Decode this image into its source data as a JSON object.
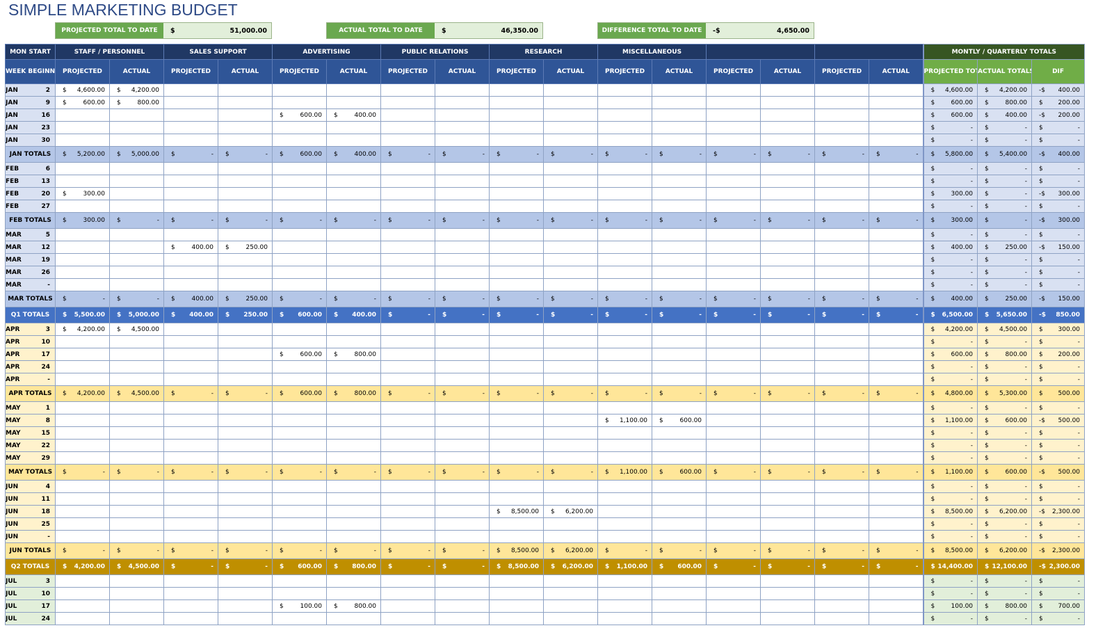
{
  "title": "SIMPLE MARKETING BUDGET",
  "summary": [
    {
      "label": "PROJECTED TOTAL TO DATE",
      "currency": "$",
      "value": "51,000.00"
    },
    {
      "label": "ACTUAL TOTAL TO DATE",
      "currency": "$",
      "value": "46,350.00"
    },
    {
      "label": "DIFFERENCE TOTAL TO DATE",
      "currency": "-$",
      "value": "4,650.00"
    }
  ],
  "header": {
    "corner_top": "MON START",
    "corner_bottom": "WEEK BEGINNING",
    "categories": [
      "STAFF / PERSONNEL",
      "SALES SUPPORT",
      "ADVERTISING",
      "PUBLIC RELATIONS",
      "RESEARCH",
      "MISCELLANEOUS",
      "",
      ""
    ],
    "sub": [
      "PROJECTED",
      "ACTUAL"
    ],
    "totals_group": "MONTLY / QUARTERLY TOTALS",
    "totals_sub": [
      "PROJECTED TOTALS",
      "ACTUAL TOTALS",
      "DIF"
    ]
  },
  "rows": [
    {
      "type": "week",
      "q": 1,
      "month": "JAN",
      "day": "2",
      "cells": {
        "0": "4,600.00",
        "1": "4,200.00"
      },
      "totals": [
        "$|4,600.00",
        "$|4,200.00",
        "-$|400.00"
      ]
    },
    {
      "type": "week",
      "q": 1,
      "month": "JAN",
      "day": "9",
      "cells": {
        "0": "600.00",
        "1": "800.00"
      },
      "totals": [
        "$|600.00",
        "$|800.00",
        "$|200.00"
      ]
    },
    {
      "type": "week",
      "q": 1,
      "month": "JAN",
      "day": "16",
      "cells": {
        "4": "600.00",
        "5": "400.00"
      },
      "totals": [
        "$|600.00",
        "$|400.00",
        "-$|200.00"
      ]
    },
    {
      "type": "week",
      "q": 1,
      "month": "JAN",
      "day": "23",
      "cells": {},
      "totals": [
        "$|-",
        "$|-",
        "$|-"
      ]
    },
    {
      "type": "week",
      "q": 1,
      "month": "JAN",
      "day": "30",
      "cells": {},
      "totals": [
        "$|-",
        "$|-",
        "$|-"
      ]
    },
    {
      "type": "month",
      "q": 1,
      "label": "JAN TOTALS",
      "values": [
        "5,200.00",
        "5,000.00",
        "-",
        "-",
        "600.00",
        "400.00",
        "-",
        "-",
        "-",
        "-",
        "-",
        "-",
        "-",
        "-",
        "-",
        "-"
      ],
      "totals": [
        "$|5,800.00",
        "$|5,400.00",
        "-$|400.00"
      ]
    },
    {
      "type": "week",
      "q": 1,
      "month": "FEB",
      "day": "6",
      "cells": {},
      "totals": [
        "$|-",
        "$|-",
        "$|-"
      ]
    },
    {
      "type": "week",
      "q": 1,
      "month": "FEB",
      "day": "13",
      "cells": {},
      "totals": [
        "$|-",
        "$|-",
        "$|-"
      ]
    },
    {
      "type": "week",
      "q": 1,
      "month": "FEB",
      "day": "20",
      "cells": {
        "0": "300.00"
      },
      "totals": [
        "$|300.00",
        "$|-",
        "-$|300.00"
      ]
    },
    {
      "type": "week",
      "q": 1,
      "month": "FEB",
      "day": "27",
      "cells": {},
      "totals": [
        "$|-",
        "$|-",
        "$|-"
      ]
    },
    {
      "type": "month",
      "q": 1,
      "label": "FEB TOTALS",
      "values": [
        "300.00",
        "-",
        "-",
        "-",
        "-",
        "-",
        "-",
        "-",
        "-",
        "-",
        "-",
        "-",
        "-",
        "-",
        "-",
        "-"
      ],
      "totals": [
        "$|300.00",
        "$|-",
        "-$|300.00"
      ]
    },
    {
      "type": "week",
      "q": 1,
      "month": "MAR",
      "day": "5",
      "cells": {},
      "totals": [
        "$|-",
        "$|-",
        "$|-"
      ]
    },
    {
      "type": "week",
      "q": 1,
      "month": "MAR",
      "day": "12",
      "cells": {
        "2": "400.00",
        "3": "250.00"
      },
      "totals": [
        "$|400.00",
        "$|250.00",
        "-$|150.00"
      ]
    },
    {
      "type": "week",
      "q": 1,
      "month": "MAR",
      "day": "19",
      "cells": {},
      "totals": [
        "$|-",
        "$|-",
        "$|-"
      ]
    },
    {
      "type": "week",
      "q": 1,
      "month": "MAR",
      "day": "26",
      "cells": {},
      "totals": [
        "$|-",
        "$|-",
        "$|-"
      ]
    },
    {
      "type": "week",
      "q": 1,
      "month": "MAR",
      "day": "-",
      "cells": {},
      "totals": [
        "$|-",
        "$|-",
        "$|-"
      ]
    },
    {
      "type": "month",
      "q": 1,
      "label": "MAR TOTALS",
      "values": [
        "-",
        "-",
        "400.00",
        "250.00",
        "-",
        "-",
        "-",
        "-",
        "-",
        "-",
        "-",
        "-",
        "-",
        "-",
        "-",
        "-"
      ],
      "totals": [
        "$|400.00",
        "$|250.00",
        "-$|150.00"
      ]
    },
    {
      "type": "quarter",
      "q": 1,
      "label": "Q1 TOTALS",
      "values": [
        "5,500.00",
        "5,000.00",
        "400.00",
        "250.00",
        "600.00",
        "400.00",
        "-",
        "-",
        "-",
        "-",
        "-",
        "-",
        "-",
        "-",
        "-",
        "-"
      ],
      "totals": [
        "$|6,500.00",
        "$|5,650.00",
        "-$|850.00"
      ]
    },
    {
      "type": "week",
      "q": 2,
      "month": "APR",
      "day": "3",
      "cells": {
        "0": "4,200.00",
        "1": "4,500.00"
      },
      "totals": [
        "$|4,200.00",
        "$|4,500.00",
        "$|300.00"
      ]
    },
    {
      "type": "week",
      "q": 2,
      "month": "APR",
      "day": "10",
      "cells": {},
      "totals": [
        "$|-",
        "$|-",
        "$|-"
      ]
    },
    {
      "type": "week",
      "q": 2,
      "month": "APR",
      "day": "17",
      "cells": {
        "4": "600.00",
        "5": "800.00"
      },
      "totals": [
        "$|600.00",
        "$|800.00",
        "$|200.00"
      ]
    },
    {
      "type": "week",
      "q": 2,
      "month": "APR",
      "day": "24",
      "cells": {},
      "totals": [
        "$|-",
        "$|-",
        "$|-"
      ]
    },
    {
      "type": "week",
      "q": 2,
      "month": "APR",
      "day": "-",
      "cells": {},
      "totals": [
        "$|-",
        "$|-",
        "$|-"
      ]
    },
    {
      "type": "month",
      "q": 2,
      "label": "APR TOTALS",
      "values": [
        "4,200.00",
        "4,500.00",
        "-",
        "-",
        "600.00",
        "800.00",
        "-",
        "-",
        "-",
        "-",
        "-",
        "-",
        "-",
        "-",
        "-",
        "-"
      ],
      "totals": [
        "$|4,800.00",
        "$|5,300.00",
        "$|500.00"
      ]
    },
    {
      "type": "week",
      "q": 2,
      "month": "MAY",
      "day": "1",
      "cells": {},
      "totals": [
        "$|-",
        "$|-",
        "$|-"
      ]
    },
    {
      "type": "week",
      "q": 2,
      "month": "MAY",
      "day": "8",
      "cells": {
        "10": "1,100.00",
        "11": "600.00"
      },
      "totals": [
        "$|1,100.00",
        "$|600.00",
        "-$|500.00"
      ]
    },
    {
      "type": "week",
      "q": 2,
      "month": "MAY",
      "day": "15",
      "cells": {},
      "totals": [
        "$|-",
        "$|-",
        "$|-"
      ]
    },
    {
      "type": "week",
      "q": 2,
      "month": "MAY",
      "day": "22",
      "cells": {},
      "totals": [
        "$|-",
        "$|-",
        "$|-"
      ]
    },
    {
      "type": "week",
      "q": 2,
      "month": "MAY",
      "day": "29",
      "cells": {},
      "totals": [
        "$|-",
        "$|-",
        "$|-"
      ]
    },
    {
      "type": "month",
      "q": 2,
      "label": "MAY TOTALS",
      "values": [
        "-",
        "-",
        "-",
        "-",
        "-",
        "-",
        "-",
        "-",
        "-",
        "-",
        "1,100.00",
        "600.00",
        "-",
        "-",
        "-",
        "-"
      ],
      "totals": [
        "$|1,100.00",
        "$|600.00",
        "-$|500.00"
      ]
    },
    {
      "type": "week",
      "q": 2,
      "month": "JUN",
      "day": "4",
      "cells": {},
      "totals": [
        "$|-",
        "$|-",
        "$|-"
      ]
    },
    {
      "type": "week",
      "q": 2,
      "month": "JUN",
      "day": "11",
      "cells": {},
      "totals": [
        "$|-",
        "$|-",
        "$|-"
      ]
    },
    {
      "type": "week",
      "q": 2,
      "month": "JUN",
      "day": "18",
      "cells": {
        "8": "8,500.00",
        "9": "6,200.00"
      },
      "totals": [
        "$|8,500.00",
        "$|6,200.00",
        "-$|2,300.00"
      ]
    },
    {
      "type": "week",
      "q": 2,
      "month": "JUN",
      "day": "25",
      "cells": {},
      "totals": [
        "$|-",
        "$|-",
        "$|-"
      ]
    },
    {
      "type": "week",
      "q": 2,
      "month": "JUN",
      "day": "-",
      "cells": {},
      "totals": [
        "$|-",
        "$|-",
        "$|-"
      ]
    },
    {
      "type": "month",
      "q": 2,
      "label": "JUN TOTALS",
      "values": [
        "-",
        "-",
        "-",
        "-",
        "-",
        "-",
        "-",
        "-",
        "8,500.00",
        "6,200.00",
        "-",
        "-",
        "-",
        "-",
        "-",
        "-"
      ],
      "totals": [
        "$|8,500.00",
        "$|6,200.00",
        "-$|2,300.00"
      ]
    },
    {
      "type": "quarter",
      "q": 2,
      "label": "Q2 TOTALS",
      "values": [
        "4,200.00",
        "4,500.00",
        "-",
        "-",
        "600.00",
        "800.00",
        "-",
        "-",
        "8,500.00",
        "6,200.00",
        "1,100.00",
        "600.00",
        "-",
        "-",
        "-",
        "-"
      ],
      "totals": [
        "$|14,400.00",
        "$|12,100.00",
        "-$|2,300.00"
      ]
    },
    {
      "type": "week",
      "q": 3,
      "month": "JUL",
      "day": "3",
      "cells": {},
      "totals": [
        "$|-",
        "$|-",
        "$|-"
      ]
    },
    {
      "type": "week",
      "q": 3,
      "month": "JUL",
      "day": "10",
      "cells": {},
      "totals": [
        "$|-",
        "$|-",
        "$|-"
      ]
    },
    {
      "type": "week",
      "q": 3,
      "month": "JUL",
      "day": "17",
      "cells": {
        "4": "100.00",
        "5": "800.00"
      },
      "totals": [
        "$|100.00",
        "$|800.00",
        "$|700.00"
      ]
    },
    {
      "type": "week",
      "q": 3,
      "month": "JUL",
      "day": "24",
      "cells": {},
      "totals": [
        "$|-",
        "$|-",
        "$|-"
      ]
    }
  ],
  "currency_symbol": "$",
  "colors": {
    "header_dark": "#203864",
    "header_mid": "#2f5597",
    "totals_header_dark": "#375623",
    "totals_header_mid": "#70ad47",
    "q1_month_total": "#b4c6e7",
    "q1_quarter_total": "#4472c4",
    "q2_month_total": "#ffe699",
    "q2_quarter_total": "#bf8f00"
  }
}
